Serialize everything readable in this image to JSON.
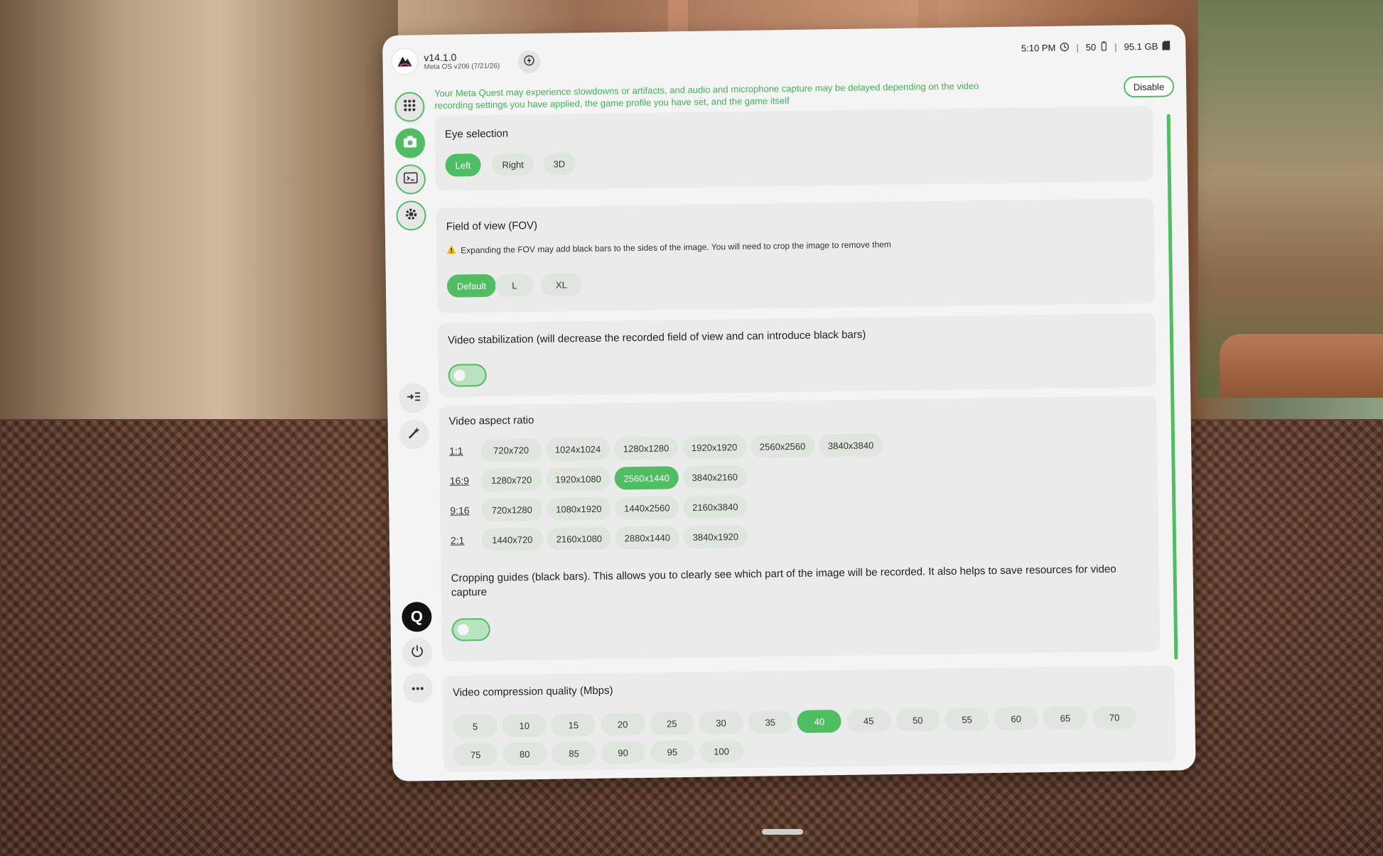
{
  "app": {
    "version": "v14.1.0",
    "os_version": "Meta OS v206 (7/21/26)"
  },
  "status": {
    "time": "5:10 PM",
    "battery": "50",
    "storage": "95.1 GB"
  },
  "warning": {
    "text": "Your Meta Quest may experience slowdowns or artifacts, and audio and microphone capture may be delayed depending on the video recording settings you have applied, the game profile you have set, and the game itself",
    "disable_label": "Disable"
  },
  "sidebar": {
    "items": [
      {
        "name": "apps",
        "icon": "grid-icon",
        "active": false
      },
      {
        "name": "camera",
        "icon": "camera-icon",
        "active": true
      },
      {
        "name": "terminal",
        "icon": "terminal-icon",
        "active": false
      },
      {
        "name": "settings",
        "icon": "gear-icon",
        "active": false
      }
    ],
    "q_label": "Q"
  },
  "eye_selection": {
    "title": "Eye selection",
    "options": [
      "Left",
      "Right",
      "3D"
    ],
    "selected": "Left"
  },
  "fov": {
    "title": "Field of view (FOV)",
    "note": "Expanding the FOV may add black bars to the sides of the image. You will need to crop the image to remove them",
    "options": [
      "Default",
      "L",
      "XL"
    ],
    "selected": "Default"
  },
  "stabilization": {
    "title": "Video stabilization (will decrease the recorded field of view and can introduce black bars)",
    "enabled": false
  },
  "aspect_ratio": {
    "title": "Video aspect ratio",
    "rows": [
      {
        "ratio": "1:1",
        "options": [
          "720x720",
          "1024x1024",
          "1280x1280",
          "1920x1920",
          "2560x2560",
          "3840x3840"
        ]
      },
      {
        "ratio": "16:9",
        "options": [
          "1280x720",
          "1920x1080",
          "2560x1440",
          "3840x2160"
        ]
      },
      {
        "ratio": "9:16",
        "options": [
          "720x1280",
          "1080x1920",
          "1440x2560",
          "2160x3840"
        ]
      },
      {
        "ratio": "2:1",
        "options": [
          "1440x720",
          "2160x1080",
          "2880x1440",
          "3840x1920"
        ]
      }
    ],
    "selected": "2560x1440",
    "cropping_title": "Cropping guides (black bars). This allows you to clearly see which part of the image will be recorded. It also helps to save resources for video capture",
    "cropping_enabled": false
  },
  "compression": {
    "title": "Video compression quality (Mbps)",
    "options": [
      "5",
      "10",
      "15",
      "20",
      "25",
      "30",
      "35",
      "40",
      "45",
      "50",
      "55",
      "60",
      "65",
      "70",
      "75",
      "80",
      "85",
      "90",
      "95",
      "100"
    ],
    "selected": "40"
  },
  "colors": {
    "accent": "#4fbe62",
    "chip": "#dfe6dd",
    "panel": "#f4f4f4"
  }
}
